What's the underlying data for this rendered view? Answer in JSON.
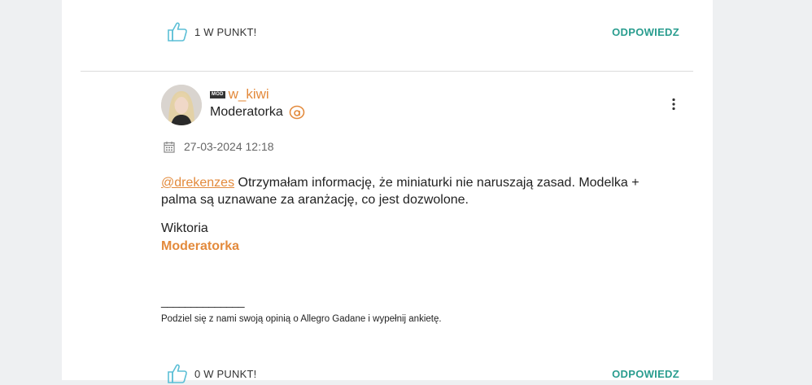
{
  "top_actions": {
    "kudos_label": "1 W PUNKT!",
    "reply_label": "ODPOWIEDZ"
  },
  "post": {
    "badge": "MOD",
    "username": "w_kiwi",
    "rank": "Moderatorka",
    "date": "27-03-2024 12:18",
    "mention": "@drekenzes",
    "message_line1": " Otrzymałam informację, że miniaturki nie naruszają zasad. Modelka +",
    "message_line2": "palma są uznawane za aranżację, co jest dozwolone.",
    "signature_name": "Wiktoria",
    "signature_role": "Moderatorka",
    "signature_separator": "______________",
    "signature_note": "Podziel się z nami swoją opinią o Allegro Gadane i wypełnij ankietę."
  },
  "bottom_actions": {
    "kudos_label": "0 W PUNKT!",
    "reply_label": "ODPOWIEDZ"
  },
  "colors": {
    "accent_orange": "#e38a3c",
    "accent_teal": "#2a9d8f",
    "thumb_icon": "#5bbfd6"
  },
  "icons": {
    "kudos": "thumbs-up-icon",
    "more": "more-vertical-icon",
    "allegro": "allegro-a-icon",
    "date": "calendar-icon"
  }
}
